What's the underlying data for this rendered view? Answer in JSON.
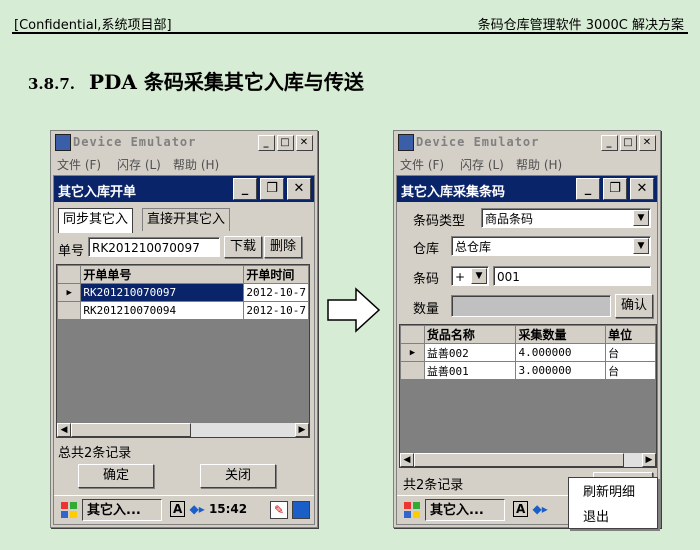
{
  "doc": {
    "header_left": "[Confidential,系统项目部]",
    "header_right": "条码仓库管理软件 3000C 解决方案",
    "section_number": "3.8.7.",
    "section_title": "PDA 条码采集其它入库与传送"
  },
  "left": {
    "emulator_title": "Device Emulator",
    "menu": [
      "文件 (F)",
      "闪存 (L)",
      "帮助 (H)"
    ],
    "app_title": "其它入库开单",
    "tabs": [
      "同步其它入",
      "直接开其它入"
    ],
    "order_label": "单号",
    "order_value": "RK201210070097",
    "download_button": "下载",
    "delete_button": "删除",
    "columns": [
      "开单单号",
      "开单时间"
    ],
    "rows": [
      {
        "order": "RK201210070097",
        "time": "2012-10-7"
      },
      {
        "order": "RK201210070094",
        "time": "2012-10-7"
      }
    ],
    "total_text": "总共2条记录",
    "confirm_button": "确定",
    "close_button": "关闭",
    "taskbar_task": "其它入...",
    "tray_input": "A",
    "clock": "15:42"
  },
  "right": {
    "emulator_title": "Device Emulator",
    "menu": [
      "文件 (F)",
      "闪存 (L)",
      "帮助 (H)"
    ],
    "app_title": "其它入库采集条码",
    "barcode_type_label": "条码类型",
    "barcode_type_value": "商品条码",
    "warehouse_label": "仓库",
    "warehouse_value": "总仓库",
    "barcode_label": "条码",
    "barcode_prefix": "+",
    "barcode_value": "001",
    "quantity_label": "数量",
    "quantity_value": "",
    "confirm_button": "确认",
    "columns": [
      "货品名称",
      "采集数量",
      "单位"
    ],
    "rows": [
      {
        "name": "益善002",
        "qty": "4.000000",
        "unit": "台"
      },
      {
        "name": "益善001",
        "qty": "3.000000",
        "unit": "台"
      }
    ],
    "total_text": "共2条记录",
    "context_menu": [
      "刷新明细",
      "退出"
    ],
    "taskbar_task": "其它入...",
    "tray_input": "A"
  }
}
